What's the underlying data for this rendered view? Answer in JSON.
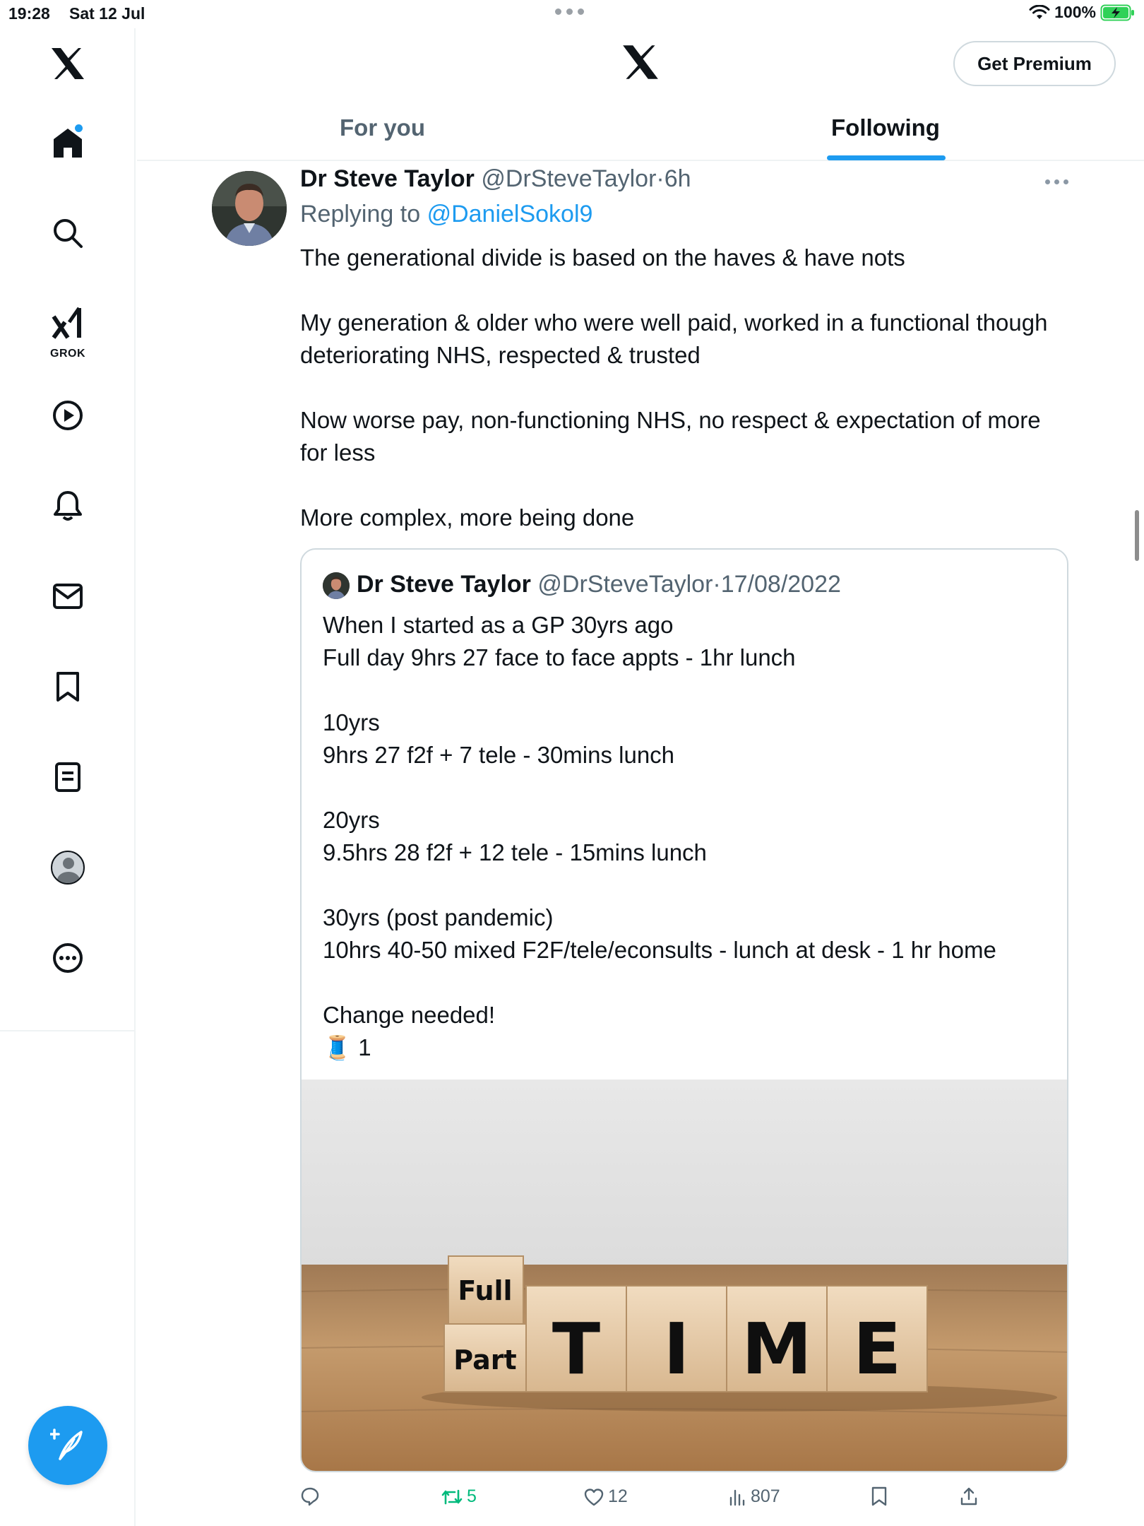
{
  "status_bar": {
    "time": "19:28",
    "date": "Sat 12 Jul",
    "battery": "100%"
  },
  "sidebar": {
    "items": [
      {
        "name": "home",
        "icon": "home-icon",
        "active": true
      },
      {
        "name": "explore",
        "icon": "search-icon"
      },
      {
        "name": "grok",
        "icon": "grok-icon",
        "label": "GROK"
      },
      {
        "name": "video",
        "icon": "play-icon"
      },
      {
        "name": "notifications",
        "icon": "bell-icon"
      },
      {
        "name": "messages",
        "icon": "mail-icon"
      },
      {
        "name": "bookmarks",
        "icon": "bookmark-icon"
      },
      {
        "name": "lists",
        "icon": "list-icon"
      },
      {
        "name": "profile",
        "icon": "profile-avatar-icon"
      },
      {
        "name": "more",
        "icon": "more-circle-icon"
      }
    ],
    "compose_icon": "compose-icon"
  },
  "header": {
    "premium_label": "Get Premium",
    "tabs": [
      {
        "label": "For you",
        "active": false
      },
      {
        "label": "Following",
        "active": true
      }
    ]
  },
  "tweet": {
    "author_name": "Dr Steve Taylor",
    "handle": "@DrSteveTaylor",
    "separator": "·",
    "time": "6h",
    "replying_prefix": "Replying to",
    "replying_to": "@DanielSokol9",
    "paragraphs": [
      "The generational divide is based on the haves & have nots",
      "My generation & older who were well paid, worked in a functional though deteriorating NHS, respected & trusted",
      "Now worse pay, non-functioning NHS, no respect & expectation of more for less",
      "More complex, more being done"
    ],
    "quote": {
      "author_name": "Dr Steve Taylor",
      "handle": "@DrSteveTaylor",
      "separator": "·",
      "date": "17/08/2022",
      "lines": [
        "When I started as a GP 30yrs ago",
        "Full day  9hrs 27 face to face appts - 1hr lunch",
        "10yrs",
        "9hrs 27 f2f + 7 tele - 30mins lunch",
        "20yrs",
        "9.5hrs 28 f2f + 12 tele - 15mins lunch",
        "30yrs (post pandemic)",
        "10hrs 40-50 mixed F2F/tele/econsults - lunch at desk - 1 hr home",
        "Change needed!",
        "🧵 1"
      ],
      "image": {
        "block_top_word": "Full",
        "block_bottom_word": "Part",
        "letters": [
          "T",
          "I",
          "M",
          "E"
        ]
      }
    },
    "actions": {
      "reply_count": "",
      "retweet_count": "5",
      "like_count": "12",
      "views_count": "807"
    }
  },
  "colors": {
    "accent": "#1d9bf0",
    "text": "#0f1419",
    "muted": "#536471",
    "retweet": "#00ba7c",
    "border": "#cfd9de"
  }
}
